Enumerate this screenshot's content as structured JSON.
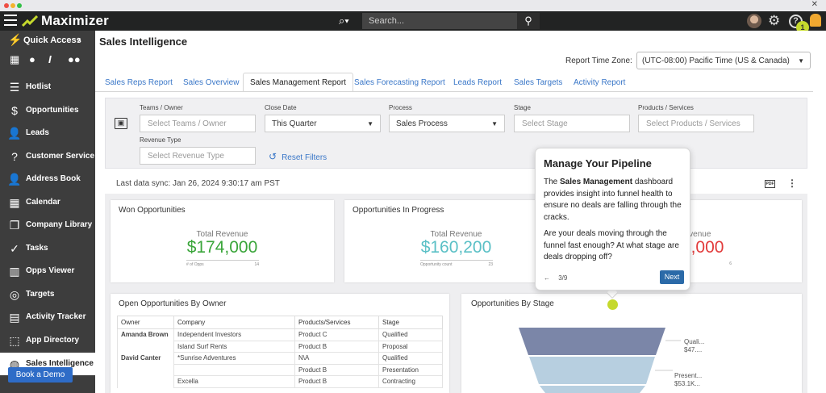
{
  "app": {
    "logo_text": "Maximizer",
    "search_placeholder": "Search...",
    "notification_count": "1",
    "close_glyph": "✕"
  },
  "sidebar": {
    "quick_access": "Quick Access",
    "items": [
      {
        "label": "Hotlist",
        "icon": "list-icon",
        "glyph": "☰"
      },
      {
        "label": "Opportunities",
        "icon": "dollar-icon",
        "glyph": "$"
      },
      {
        "label": "Leads",
        "icon": "leads-icon",
        "glyph": "👤"
      },
      {
        "label": "Customer Service",
        "icon": "chat-icon",
        "glyph": "?"
      },
      {
        "label": "Address Book",
        "icon": "address-book-icon",
        "glyph": "👤"
      },
      {
        "label": "Calendar",
        "icon": "calendar-icon",
        "glyph": "▦"
      },
      {
        "label": "Company Library",
        "icon": "library-icon",
        "glyph": "❐"
      },
      {
        "label": "Tasks",
        "icon": "check-icon",
        "glyph": "✓"
      },
      {
        "label": "Opps Viewer",
        "icon": "viewer-icon",
        "glyph": "▥"
      },
      {
        "label": "Targets",
        "icon": "target-icon",
        "glyph": "◎"
      },
      {
        "label": "Activity Tracker",
        "icon": "tracker-icon",
        "glyph": "▤"
      },
      {
        "label": "App Directory",
        "icon": "app-directory-icon",
        "glyph": "⬚"
      },
      {
        "label": "Sales Intelligence",
        "icon": "globe-icon",
        "glyph": "◍"
      }
    ],
    "book_demo": "Book a Demo"
  },
  "page": {
    "title": "Sales Intelligence",
    "tz_label": "Report Time Zone:",
    "tz_value": "(UTC-08:00) Pacific Time (US & Canada)"
  },
  "tabs": [
    "Sales Reps Report",
    "Sales Overview",
    "Sales Management Report",
    "Sales Forecasting Report",
    "Leads Report",
    "Sales Targets",
    "Activity Report"
  ],
  "filters": {
    "teams_label": "Teams / Owner",
    "teams_placeholder": "Select Teams / Owner",
    "close_label": "Close Date",
    "close_value": "This Quarter",
    "process_label": "Process",
    "process_value": "Sales Process",
    "stage_label": "Stage",
    "stage_placeholder": "Select Stage",
    "products_label": "Products / Services",
    "products_placeholder": "Select Products / Services",
    "revenue_label": "Revenue Type",
    "revenue_placeholder": "Select Revenue Type",
    "reset": "Reset Filters"
  },
  "sync": "Last data sync: Jan 26, 2024 9:30:17 am PST",
  "pdf_label": "PDF",
  "cards": {
    "won": {
      "title": "Won Opportunities",
      "sub": "Total Revenue",
      "value": "$174,000",
      "foot_label": "# of Opps",
      "foot_value": "14",
      "color": "#3aa53a"
    },
    "progress": {
      "title": "Opportunities In Progress",
      "sub": "Total Revenue",
      "value": "$160,200",
      "foot_label": "Opportunity count",
      "foot_value": "23",
      "color": "#5bc0c6"
    },
    "lost": {
      "sub": "evenue",
      "value": ",000",
      "foot_value": "6",
      "color": "#e23b3b"
    }
  },
  "owners_table": {
    "title": "Open Opportunities By Owner",
    "headers": [
      "Owner",
      "Company",
      "Products/Services",
      "Stage"
    ],
    "rows": [
      [
        "Amanda Brown",
        "Independent Investors",
        "Product C",
        "Qualified"
      ],
      [
        "",
        "Island Surf Rents",
        "Product B",
        "Proposal"
      ],
      [
        "David Canter",
        "*Sunrise Adventures",
        "N\\A",
        "Qualified"
      ],
      [
        "",
        "",
        "Product B",
        "Presentation"
      ],
      [
        "",
        "Excella",
        "Product B",
        "Contracting"
      ]
    ]
  },
  "funnel": {
    "title": "Opportunities By Stage",
    "labels": [
      {
        "line1": "Quali...",
        "line2": "$47...."
      },
      {
        "line1": "Present...",
        "line2": "$53.1K..."
      }
    ]
  },
  "tooltip": {
    "title": "Manage Your Pipeline",
    "p1_pre": "The ",
    "p1_bold": "Sales Management",
    "p1_post": " dashboard provides insight into funnel health to ensure no deals are falling through the cracks.",
    "p2": "Are your deals moving through the funnel fast enough? At what stage are deals dropping off?",
    "step": "3/9",
    "next": "Next"
  }
}
